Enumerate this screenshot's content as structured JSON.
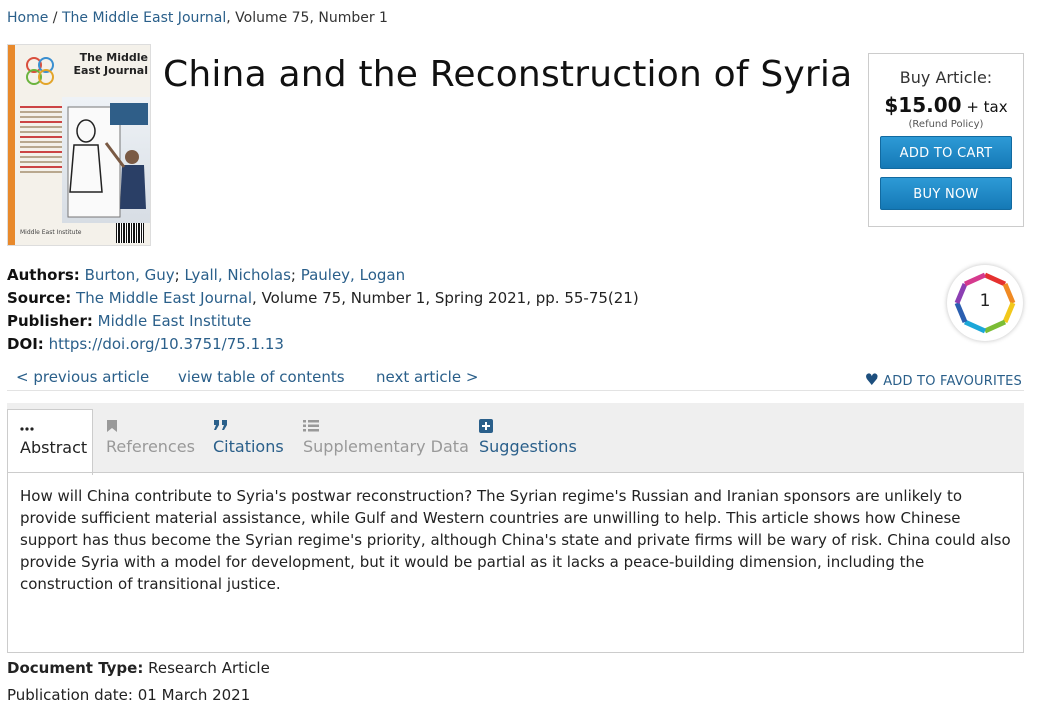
{
  "breadcrumb": {
    "home": "Home",
    "sep": " / ",
    "journal": "The Middle East Journal",
    "issue": ", Volume 75, Number 1"
  },
  "cover": {
    "journal_title": "The Middle East Journal",
    "publisher_short": "Middle East Institute"
  },
  "article": {
    "title": "China and the Reconstruction of Syria"
  },
  "buy": {
    "label": "Buy Article:",
    "price": "$15.00",
    "tax": "+ tax",
    "refund": "(Refund Policy)",
    "add_to_cart": "ADD TO CART",
    "buy_now": "BUY NOW"
  },
  "meta": {
    "authors_label": "Authors:",
    "authors": [
      "Burton, Guy",
      "Lyall, Nicholas",
      "Pauley, Logan"
    ],
    "source_label": "Source:",
    "source_journal": "The Middle East Journal",
    "source_rest": ", Volume 75, Number 1, Spring 2021, pp. 55-75(21)",
    "publisher_label": "Publisher:",
    "publisher": "Middle East Institute",
    "doi_label": "DOI:",
    "doi": "https://doi.org/10.3751/75.1.13"
  },
  "altmetric": {
    "score": "1"
  },
  "nav": {
    "previous": "< previous article",
    "toc": "view table of contents",
    "next": "next article >",
    "favourites": "ADD TO FAVOURITES"
  },
  "tabs": [
    {
      "label": "Abstract",
      "icon": "ellipsis-icon",
      "state": "active"
    },
    {
      "label": "References",
      "icon": "bookmark-icon",
      "state": "disabled"
    },
    {
      "label": "Citations",
      "icon": "quote-icon",
      "state": "enabled"
    },
    {
      "label": "Supplementary Data",
      "icon": "list-icon",
      "state": "disabled"
    },
    {
      "label": "Suggestions",
      "icon": "plus-box-icon",
      "state": "enabled"
    }
  ],
  "abstract": "How will China contribute to Syria's postwar reconstruction? The Syrian regime's Russian and Iranian sponsors are unlikely to provide sufficient material assistance, while Gulf and Western countries are unwilling to help. This article shows how Chinese support has thus become the Syrian regime's priority, although China's state and private firms will be wary of risk. China could also provide Syria with a model for development, but it would be partial as it lacks a peace-building dimension, including the construction of transitional justice.",
  "document": {
    "type_label": "Document Type:",
    "type": "Research Article",
    "date_label": "Publication date:",
    "date": "01 March 2021"
  },
  "colors": {
    "link": "#2a5f8a",
    "button": "#1a86c6",
    "cover_accent": "#e8892b"
  }
}
